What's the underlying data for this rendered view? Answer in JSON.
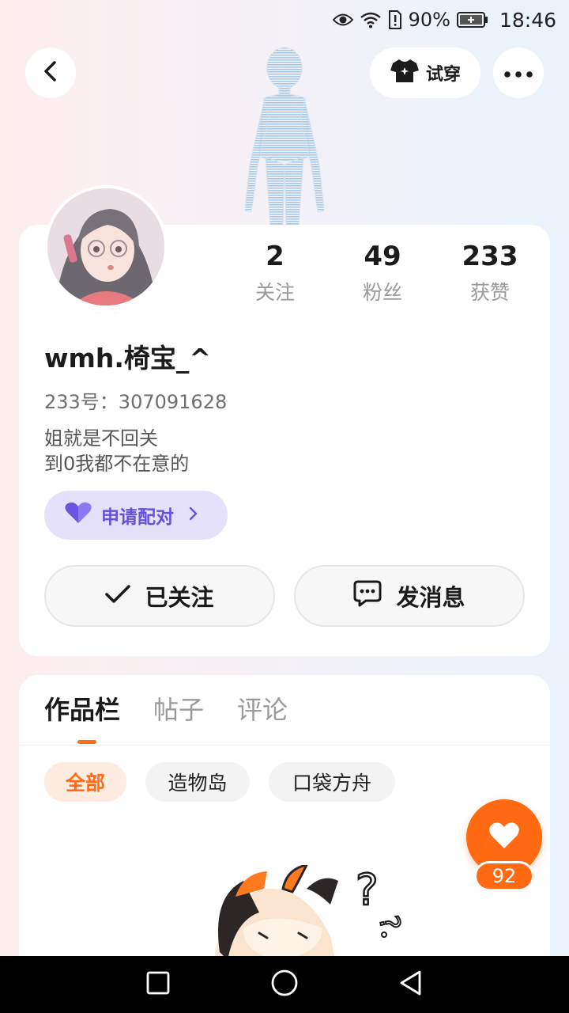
{
  "status_bar": {
    "battery": "90%",
    "time": "18:46"
  },
  "header": {
    "try_on_label": "试穿"
  },
  "profile": {
    "stats": [
      {
        "value": "2",
        "label": "关注"
      },
      {
        "value": "49",
        "label": "粉丝"
      },
      {
        "value": "233",
        "label": "获赞"
      }
    ],
    "username": "wmh.椅宝_^",
    "uid": "233号：307091628",
    "bio_line1": "姐就是不回关",
    "bio_line2": "到0我都不在意的",
    "pair_label": "申请配对",
    "follow_label": "已关注",
    "message_label": "发消息"
  },
  "content": {
    "tabs": [
      {
        "label": "作品栏",
        "active": true
      },
      {
        "label": "帖子",
        "active": false
      },
      {
        "label": "评论",
        "active": false
      }
    ],
    "filters": [
      {
        "label": "全部",
        "active": true
      },
      {
        "label": "造物岛",
        "active": false
      },
      {
        "label": "口袋方舟",
        "active": false
      }
    ]
  },
  "like": {
    "count": "92"
  },
  "colors": {
    "accent": "#ff6a12",
    "pair_bg": "#e6e1fb",
    "pair_text": "#6651d9"
  }
}
